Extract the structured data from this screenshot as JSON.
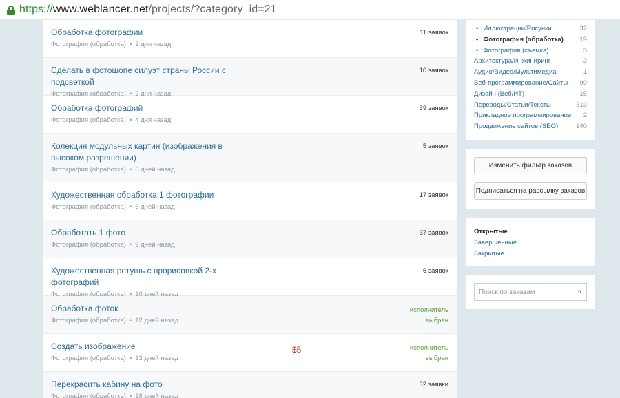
{
  "addressbar": {
    "scheme": "https://",
    "host": "www.weblancer.net",
    "path": "/projects/?category_id=21"
  },
  "projects": [
    {
      "title": "Обработка фотографии",
      "category": "Фотография (обработка)",
      "time": "2 дня назад",
      "count": "11 заявок"
    },
    {
      "title": "Сделать в фотошопе силуэт страны России с подсветкой",
      "category": "Фотография (обработка)",
      "time": "2 дня назад",
      "count": "10 заявок"
    },
    {
      "title": "Обработка фотографий",
      "category": "Фотография (обработка)",
      "time": "4 дня назад",
      "count": "39 заявок"
    },
    {
      "title": "Колекция модульных картин (изображения в высоком разрешении)",
      "category": "Фотография (обработка)",
      "time": "5 дней назад",
      "count": "5 заявок"
    },
    {
      "title": "Художественная обработка 1 фотографии",
      "category": "Фотография (обработка)",
      "time": "6 дней назад",
      "count": "17 заявок"
    },
    {
      "title": "Обработать 1 фото",
      "category": "Фотография (обработка)",
      "time": "9 дней назад",
      "count": "37 заявок"
    },
    {
      "title": "Художественная ретушь с прорисовкой 2-х фотографий",
      "category": "Фотография (обработка)",
      "time": "10 дней назад",
      "count": "6 заявок"
    },
    {
      "title": "Обработка фоток",
      "category": "Фотография (обработка)",
      "time": "12 дней назад",
      "selected_line1": "исполнитель",
      "selected_line2": "выбран"
    },
    {
      "title": "Создать изображение",
      "category": "Фотография (обработка)",
      "time": "13 дней назад",
      "price": "$5",
      "selected_line1": "исполнитель",
      "selected_line2": "выбран"
    },
    {
      "title": "Перекрасить кабину на фото",
      "category": "Фотография (обработка)",
      "time": "18 дней назад",
      "count": "32 заявки"
    }
  ],
  "categories": [
    {
      "label": "Иллюстрации/Рисунки",
      "count": "32"
    },
    {
      "label": "Фотография (обработка)",
      "count": "19"
    },
    {
      "label": "Фотография (съемка)",
      "count": "3"
    },
    {
      "label": "Архитектура/Инжиниринг",
      "count": "3"
    },
    {
      "label": "Аудио/Видео/Мультимедиа",
      "count": "1"
    },
    {
      "label": "Веб-программирование/Сайты",
      "count": "99"
    },
    {
      "label": "Дизайн (Веб/ИТ)",
      "count": "15"
    },
    {
      "label": "Переводы/Статьи/Тексты",
      "count": "313"
    },
    {
      "label": "Прикладное программирование",
      "count": "2"
    },
    {
      "label": "Продвижение сайтов (SEO)",
      "count": "140"
    }
  ],
  "buttons": {
    "change_filter": "Изменить фильтр заказов",
    "subscribe": "Подписаться на рассылку заказов"
  },
  "statuses": {
    "open": "Открытые",
    "completed": "Завершенные",
    "closed": "Закрытые"
  },
  "search": {
    "placeholder": "Поиск по заказам",
    "go": "»"
  },
  "separator": "•"
}
